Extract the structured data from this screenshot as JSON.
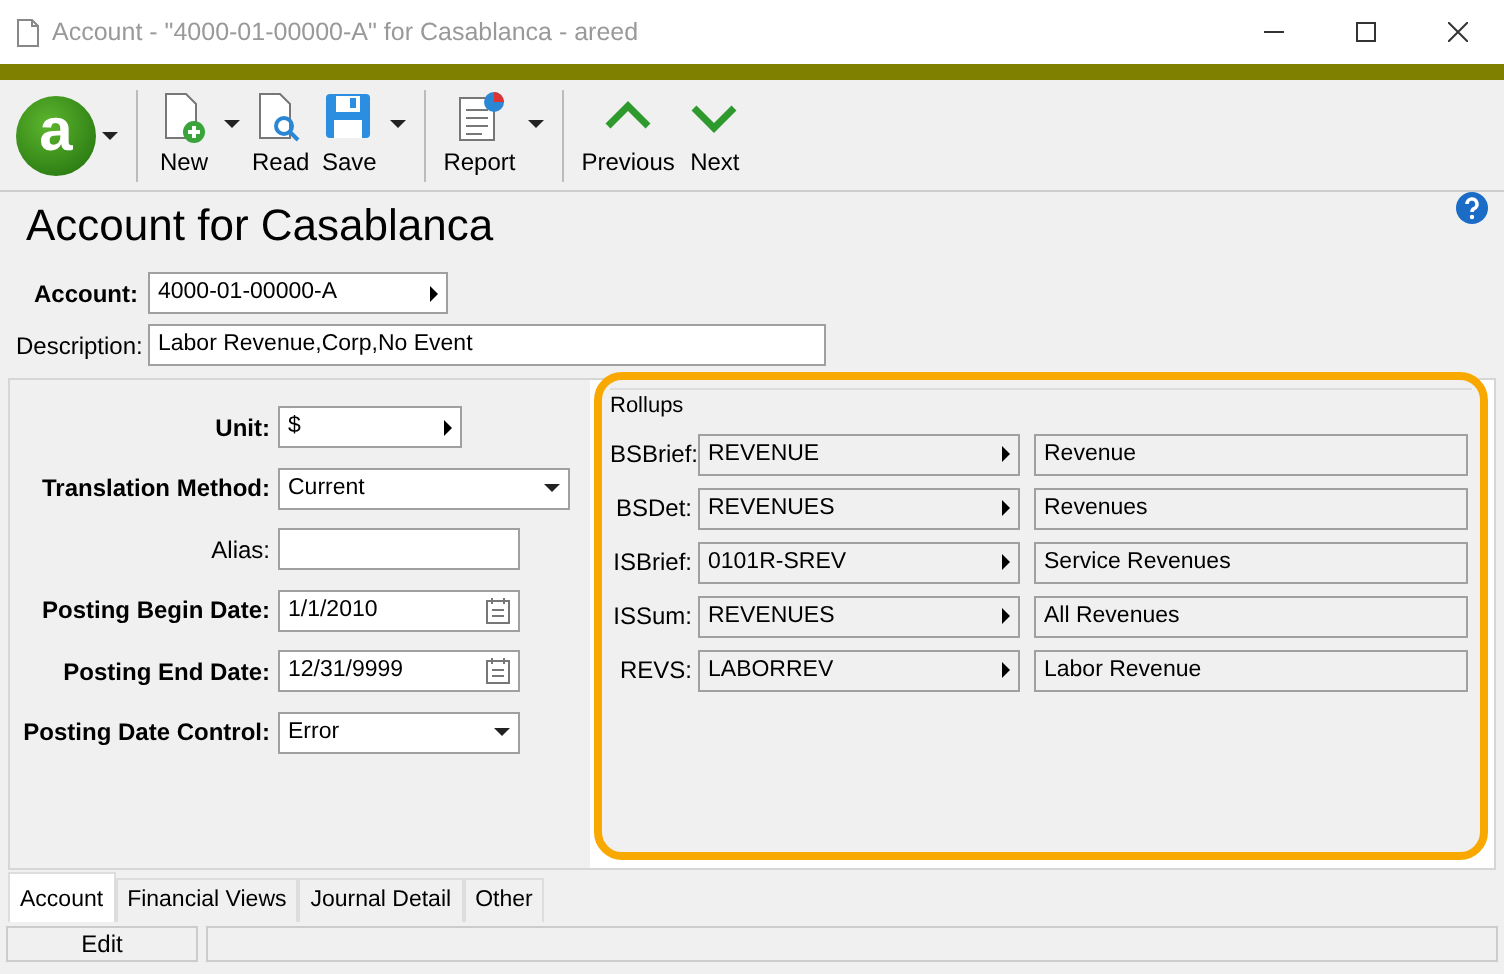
{
  "window": {
    "title": "Account - \"4000-01-00000-A\" for Casablanca - areed"
  },
  "toolbar": {
    "logo_text": "a",
    "buttons": [
      {
        "kind": "new",
        "label": "New",
        "dropdown": true
      },
      {
        "kind": "read",
        "label": "Read",
        "dropdown": false
      },
      {
        "kind": "save",
        "label": "Save",
        "dropdown": true
      },
      {
        "kind": "report",
        "label": "Report",
        "dropdown": true
      },
      {
        "kind": "previous",
        "label": "Previous",
        "dropdown": false
      },
      {
        "kind": "next",
        "label": "Next",
        "dropdown": false
      }
    ]
  },
  "heading": "Account for Casablanca",
  "account": {
    "label": "Account:",
    "value": "4000-01-00000-A"
  },
  "description": {
    "label": "Description:",
    "value": "Labor Revenue,Corp,No Event"
  },
  "fields": [
    {
      "kind": "lookup",
      "label": "Unit:",
      "value": "$",
      "bold": true
    },
    {
      "kind": "dropdown",
      "label": "Translation Method:",
      "value": "Current",
      "bold": true
    },
    {
      "kind": "text",
      "label": "Alias:",
      "bold": false
    },
    {
      "kind": "date",
      "label": "Posting Begin Date:",
      "value": "1/1/2010",
      "bold": true
    },
    {
      "kind": "date",
      "label": "Posting End Date:",
      "value": "12/31/9999",
      "bold": true
    },
    {
      "kind": "dropdown",
      "label": "Posting Date Control:",
      "value": "Error",
      "bold": true
    }
  ],
  "rollups": {
    "title": "Rollups",
    "rows": [
      {
        "label": "BSBrief:",
        "code": "REVENUE",
        "name": "Revenue"
      },
      {
        "label": "BSDet:",
        "code": "REVENUES",
        "name": "Revenues"
      },
      {
        "label": "ISBrief:",
        "code": "0101R-SREV",
        "name": "Service Revenues"
      },
      {
        "label": "ISSum:",
        "code": "REVENUES",
        "name": "All Revenues"
      },
      {
        "label": "REVS:",
        "code": "LABORREV",
        "name": "Labor Revenue"
      }
    ]
  },
  "tabs": [
    {
      "label": "Account",
      "selected": true
    },
    {
      "label": "Financial Views",
      "selected": false
    },
    {
      "label": "Journal Detail",
      "selected": false
    },
    {
      "label": "Other",
      "selected": false
    }
  ],
  "status_bar": {
    "mode": "Edit"
  }
}
